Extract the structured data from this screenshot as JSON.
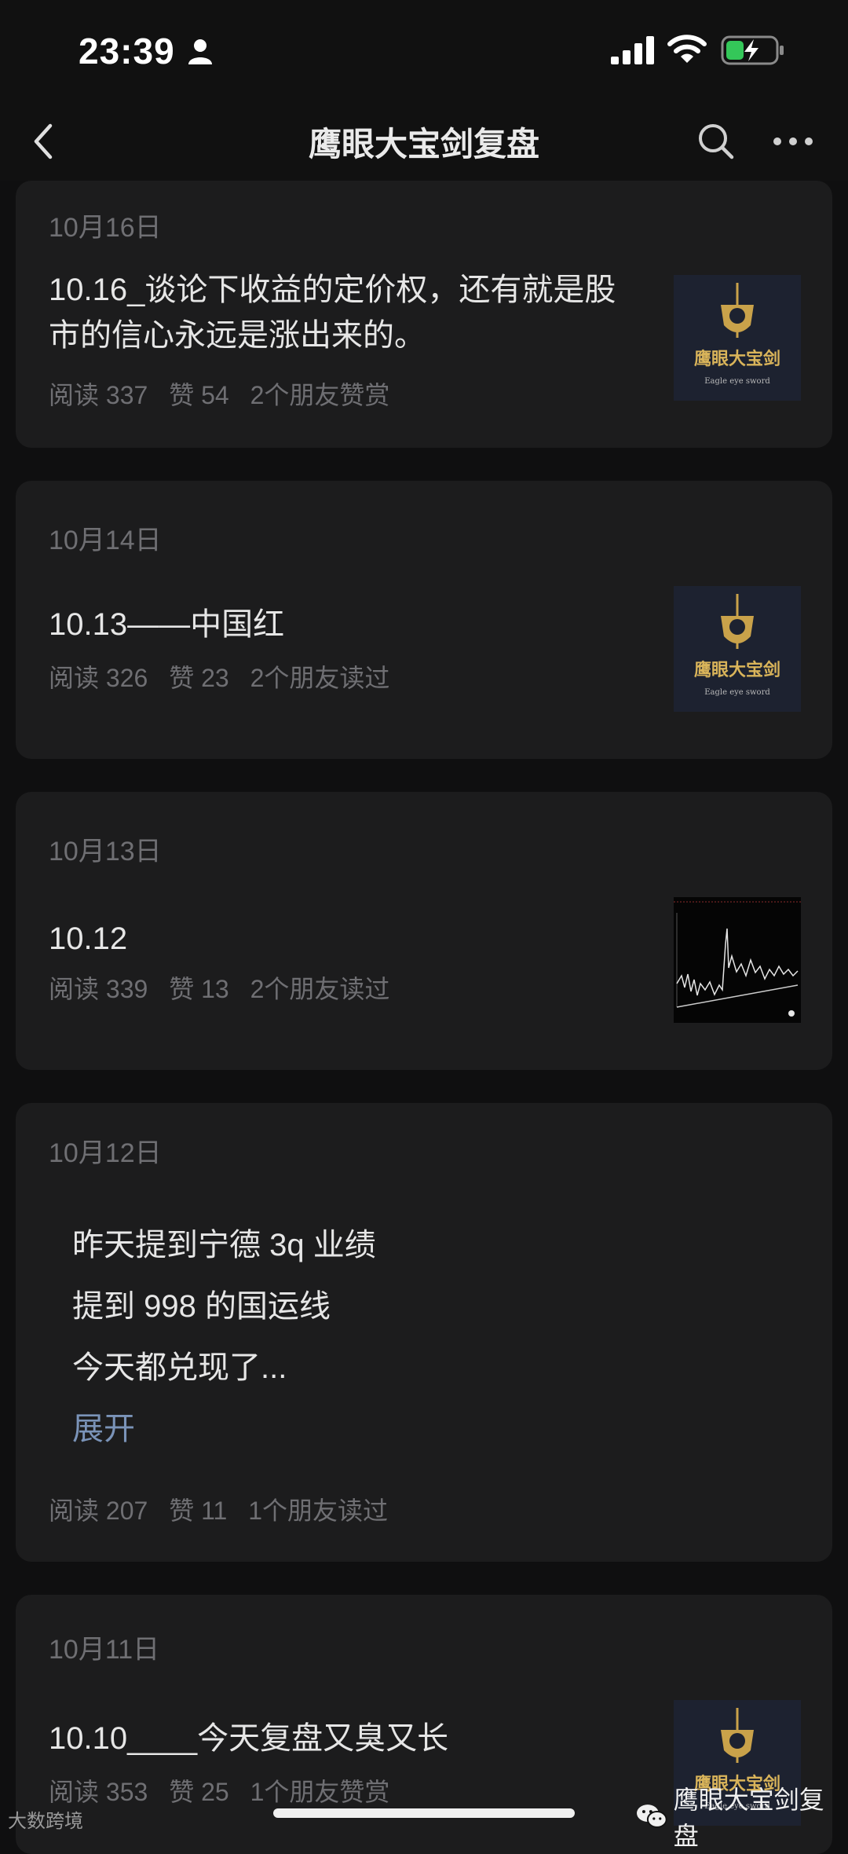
{
  "status_bar": {
    "time": "23:39"
  },
  "nav": {
    "title": "鹰眼大宝剑复盘"
  },
  "thumb_brand": {
    "name": "鹰眼大宝剑",
    "sub": "Eagle eye sword"
  },
  "articles": [
    {
      "date": "10月16日",
      "title": "10.16_谈论下收益的定价权，还有就是股市的信心永远是涨出来的。",
      "reads": "阅读 337",
      "likes": "赞 54",
      "friends": "2个朋友赞赏"
    },
    {
      "date": "10月14日",
      "title": "10.13——中国红",
      "reads": "阅读 326",
      "likes": "赞 23",
      "friends": "2个朋友读过"
    },
    {
      "date": "10月13日",
      "title": "10.12",
      "reads": "阅读 339",
      "likes": "赞 13",
      "friends": "2个朋友读过"
    },
    {
      "date": "10月12日",
      "lines": [
        "昨天提到宁德 3q 业绩",
        "提到 998 的国运线",
        "今天都兑现了..."
      ],
      "expand": "展开",
      "reads": "阅读 207",
      "likes": "赞 11",
      "friends": "1个朋友读过"
    },
    {
      "date": "10月11日",
      "title": "10.10____今天复盘又臭又长",
      "reads": "阅读 353",
      "likes": "赞 25",
      "friends": "1个朋友赞赏"
    }
  ],
  "watermark_left": "大数跨境",
  "watermark_right": "鹰眼大宝剑复盘"
}
